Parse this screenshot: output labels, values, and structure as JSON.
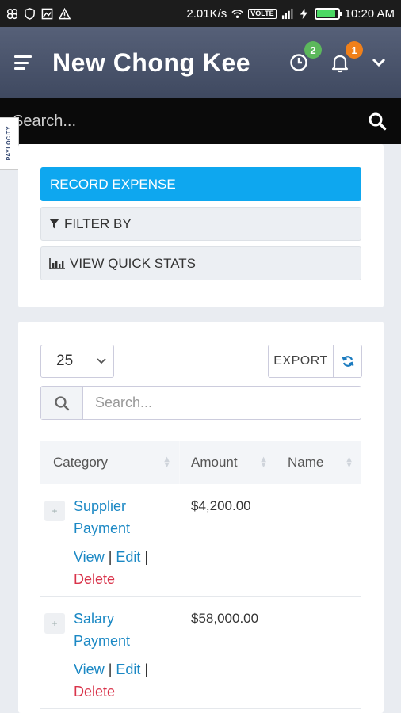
{
  "status_bar": {
    "speed": "2.01K/s",
    "network": "VOLTE",
    "time": "10:20 AM"
  },
  "header": {
    "title": "New Chong Kee",
    "history_badge": "2",
    "notifications_badge": "1"
  },
  "search": {
    "placeholder": "Search..."
  },
  "side_tab": {
    "label": "PAYLOCITY"
  },
  "actions_card": {
    "record_label": "RECORD EXPENSE",
    "filter_label": "FILTER BY",
    "stats_label": "VIEW QUICK STATS"
  },
  "table_controls": {
    "page_size": "25",
    "export_label": "EXPORT",
    "search_placeholder": "Search..."
  },
  "table": {
    "columns": [
      "Category",
      "Amount",
      "Name"
    ],
    "rows": [
      {
        "category": "Supplier Payment",
        "amount": "$4,200.00",
        "name": "",
        "view": "View",
        "edit": "Edit",
        "delete": "Delete"
      },
      {
        "category": "Salary Payment",
        "amount": "$58,000.00",
        "name": "",
        "view": "View",
        "edit": "Edit",
        "delete": "Delete"
      }
    ]
  },
  "colors": {
    "accent": "#0ea7ef",
    "header": "#4b556c",
    "link": "#1b88c4",
    "danger": "#d9334a",
    "badge_green": "#5cb85c",
    "badge_orange": "#f0801a"
  }
}
